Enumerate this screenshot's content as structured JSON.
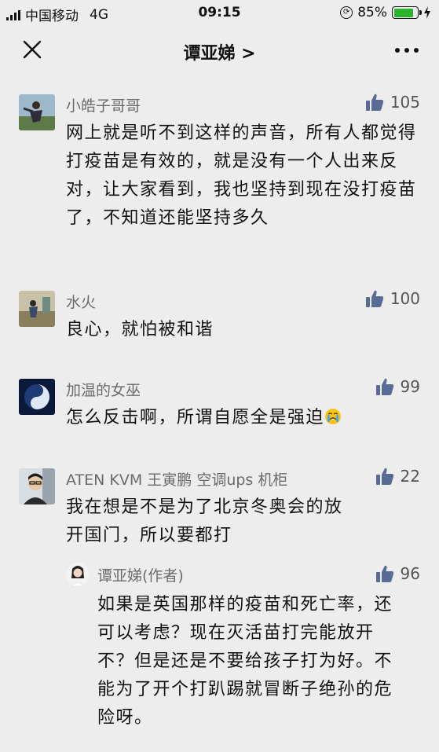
{
  "status_bar": {
    "carrier": "中国移动",
    "network": "4G",
    "time": "09:15",
    "battery_percent": "85%",
    "battery_level": 0.85
  },
  "nav": {
    "title": "谭亚娣 >",
    "close_icon": "close-icon",
    "more_icon": "more-icon"
  },
  "comments": [
    {
      "name": "小皓子哥哥",
      "likes": "105",
      "text": "网上就是听不到这样的声音，所有人都觉得打疫苗是有效的，就是没有一个人出来反对，让大家看到，我也坚持到现在没打疫苗了，不知道还能坚持多久"
    },
    {
      "name": "水火",
      "likes": "100",
      "text": "良心，就怕被和谐"
    },
    {
      "name": "加温的女巫",
      "likes": "99",
      "text": "怎么反击啊，所谓自愿全是强迫"
    },
    {
      "name": "ATEN KVM 王寅鹏 空调ups 机柜",
      "likes": "22",
      "text": "我在想是不是为了北京冬奥会的放开国门，所以要都打"
    },
    {
      "name": "谭亚娣(作者)",
      "likes": "96",
      "text": "如果是英国那样的疫苗和死亡率，还可以考虑？现在灭活苗打完能放开不？但是还是不要给孩子打为好。不能为了开个打趴踢就冒断子绝孙的危险呀。"
    }
  ],
  "colors": {
    "background": "#ededed",
    "like_blue": "#576b95"
  }
}
